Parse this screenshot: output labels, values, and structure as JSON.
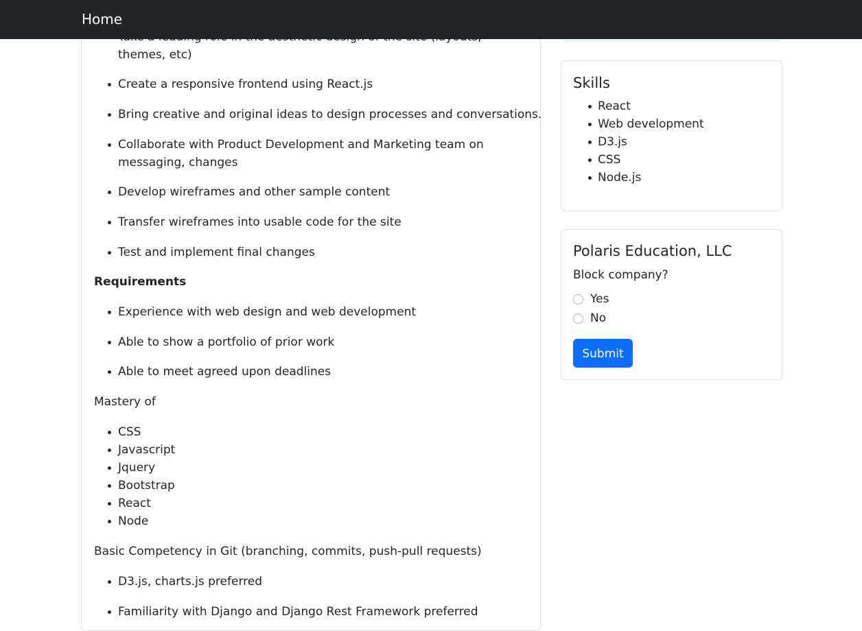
{
  "navbar": {
    "brand": "Home"
  },
  "main": {
    "responsibilities_cont": [
      "Take a leading role in the aesthetic design of the site (layouts, themes, etc)",
      "Create a responsive frontend using React.js",
      "Bring creative and original ideas to design processes and conversations.",
      "Collaborate with Product Development and Marketing team on messaging, changes",
      "Develop wireframes and other sample content",
      "Transfer wireframes into usable code for the site",
      "Test and implement final changes"
    ],
    "requirements_heading": "Requirements",
    "requirements": [
      "Experience with web design and web development",
      "Able to show a portfolio of prior work",
      "Able to meet agreed upon deadlines"
    ],
    "mastery_heading": "Mastery of",
    "mastery": [
      "CSS",
      "Javascript",
      "Jquery",
      "Bootstrap",
      "React",
      "Node"
    ],
    "git_text": "Basic Competency in Git (branching, commits, push-pull requests)",
    "preferred": [
      "D3.js, charts.js preferred",
      "Familiarity with Django and Django Rest Framework preferred"
    ]
  },
  "sidebar": {
    "skills_title": "Skills",
    "skills": [
      "React",
      "Web development",
      "D3.js",
      "CSS",
      "Node.js"
    ],
    "company_title": "Polaris Education, LLC",
    "block_question": "Block company?",
    "options": [
      "Yes",
      "No"
    ],
    "submit_label": "Submit"
  },
  "colors": {
    "navbar_bg": "#212529",
    "primary": "#0d6efd",
    "border": "#dee2e6",
    "text": "#212529"
  }
}
